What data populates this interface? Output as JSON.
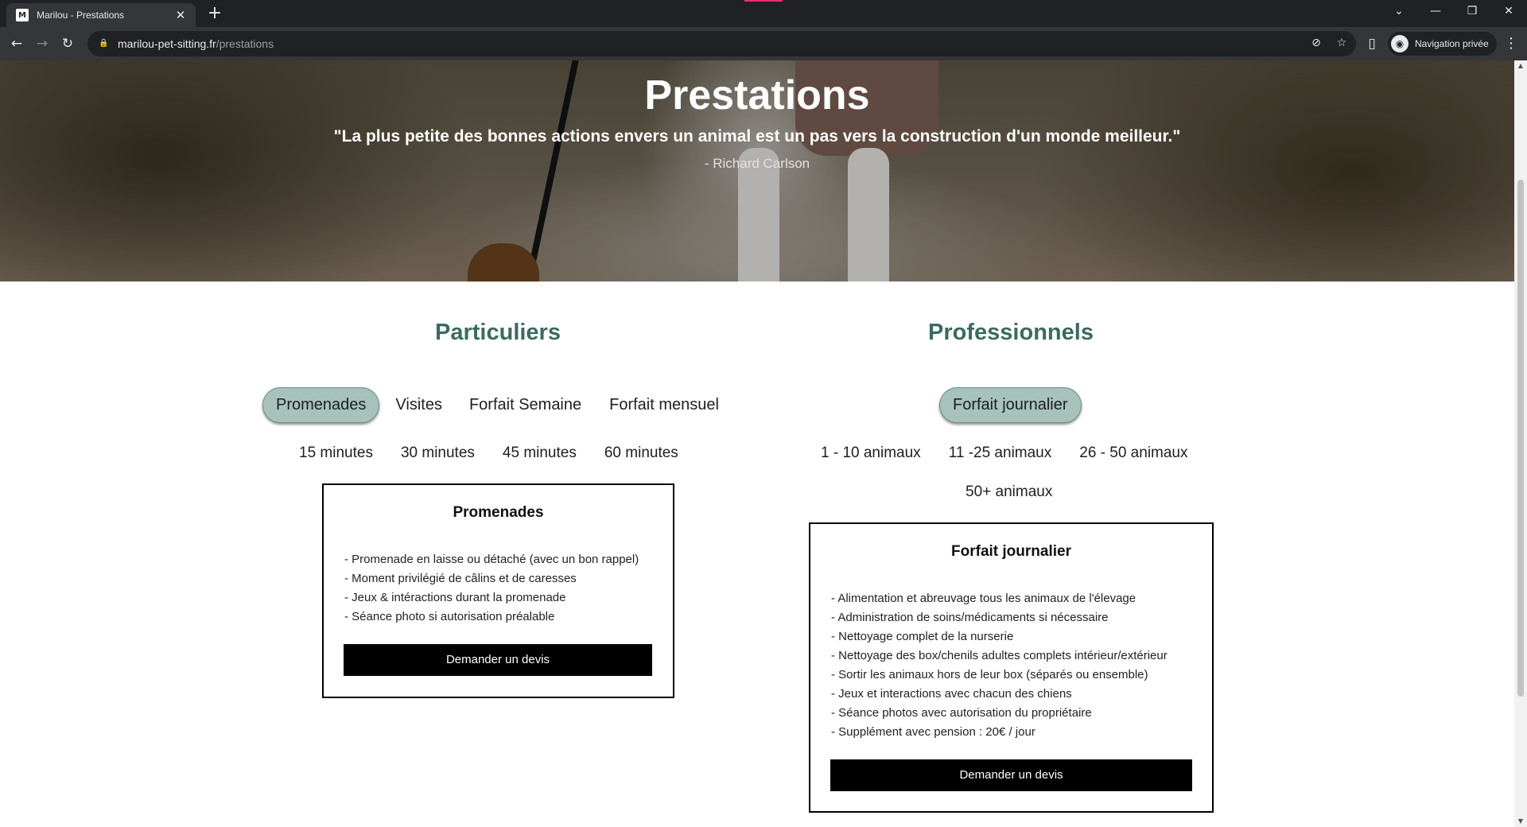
{
  "browser": {
    "tab_title": "Marilou - Prestations",
    "favicon_letter": "M",
    "url_host": "marilou-pet-sitting.fr",
    "url_path": "/prestations",
    "profile_label": "Navigation privée",
    "accent_color": "#e2336b"
  },
  "hero": {
    "title": "Prestations",
    "quote": "\"La plus petite des bonnes actions envers un animal est un pas vers la construction d'un monde meilleur.\"",
    "author": "- Richard Carlson"
  },
  "particuliers": {
    "title": "Particuliers",
    "tabs": [
      {
        "label": "Promenades",
        "active": true
      },
      {
        "label": "Visites",
        "active": false
      },
      {
        "label": "Forfait Semaine",
        "active": false
      },
      {
        "label": "Forfait mensuel",
        "active": false
      }
    ],
    "durations": [
      "15 minutes",
      "30 minutes",
      "45 minutes",
      "60 minutes"
    ],
    "card": {
      "title": "Promenades",
      "items": [
        "- Promenade en laisse ou détaché (avec un bon rappel)",
        "- Moment privilégié de câlins et de caresses",
        "- Jeux & intéractions durant la promenade",
        "- Séance photo si autorisation préalable"
      ],
      "button": "Demander un devis"
    }
  },
  "professionnels": {
    "title": "Professionnels",
    "tabs": [
      {
        "label": "Forfait journalier",
        "active": true
      }
    ],
    "sizes": [
      "1 - 10 animaux",
      "11 -25 animaux",
      "26 - 50 animaux",
      "50+ animaux"
    ],
    "card": {
      "title": "Forfait journalier",
      "items": [
        "- Alimentation et abreuvage tous les animaux de l'élevage",
        "- Administration de soins/médicaments si nécessaire",
        "- Nettoyage complet de la nurserie",
        "- Nettoyage des box/chenils adultes complets intérieur/extérieur",
        "- Sortir les animaux hors de leur box (séparés ou ensemble)",
        "- Jeux et interactions avec chacun des chiens",
        "- Séance photos avec autorisation du propriétaire",
        "- Supplément avec pension : 20€ / jour"
      ],
      "button": "Demander un devis"
    }
  },
  "colors": {
    "heading": "#3b6b5f",
    "active_pill": "#a6c2bb"
  },
  "icons": {
    "back": "arrow-left-icon",
    "forward": "arrow-right-icon",
    "reload": "reload-icon",
    "lock": "lock-icon",
    "eye_off": "eye-off-icon",
    "bookmark": "star-icon",
    "sidepanel": "side-panel-icon",
    "incognito": "incognito-icon",
    "menu": "more-vert-icon"
  }
}
